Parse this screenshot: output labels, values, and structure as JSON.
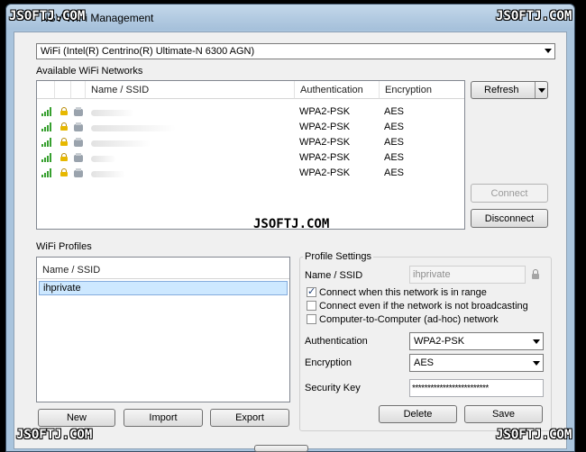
{
  "window": {
    "title": "NSV WiFi Management"
  },
  "adapter": {
    "selected": "WiFi (Intel(R) Centrino(R) Ultimate-N 6300 AGN)"
  },
  "networks": {
    "section_label": "Available WiFi Networks",
    "columns": [
      "Name / SSID",
      "Authentication",
      "Encryption"
    ],
    "rows": [
      {
        "auth": "WPA2-PSK",
        "enc": "AES"
      },
      {
        "auth": "WPA2-PSK",
        "enc": "AES"
      },
      {
        "auth": "WPA2-PSK",
        "enc": "AES"
      },
      {
        "auth": "WPA2-PSK",
        "enc": "AES"
      },
      {
        "auth": "WPA2-PSK",
        "enc": "AES"
      }
    ],
    "refresh_label": "Refresh",
    "connect_label": "Connect",
    "disconnect_label": "Disconnect"
  },
  "profiles": {
    "section_label": "WiFi Profiles",
    "column": "Name / SSID",
    "items": [
      "ihprivate"
    ],
    "new_label": "New",
    "import_label": "Import",
    "export_label": "Export"
  },
  "settings": {
    "section_label": "Profile Settings",
    "name_label": "Name / SSID",
    "name_value": "ihprivate",
    "opt_connect_in_range": "Connect when this network is in range",
    "opt_connect_not_broadcasting": "Connect even if the network is not broadcasting",
    "opt_adhoc": "Computer-to-Computer (ad-hoc) network",
    "auth_label": "Authentication",
    "auth_value": "WPA2-PSK",
    "enc_label": "Encryption",
    "enc_value": "AES",
    "key_label": "Security Key",
    "key_value": "*************************",
    "delete_label": "Delete",
    "save_label": "Save"
  },
  "watermark": "JSOFTJ.COM",
  "colors": {
    "signal": "#37a02f",
    "lock": "#e7b800",
    "selection": "#cde8ff"
  }
}
